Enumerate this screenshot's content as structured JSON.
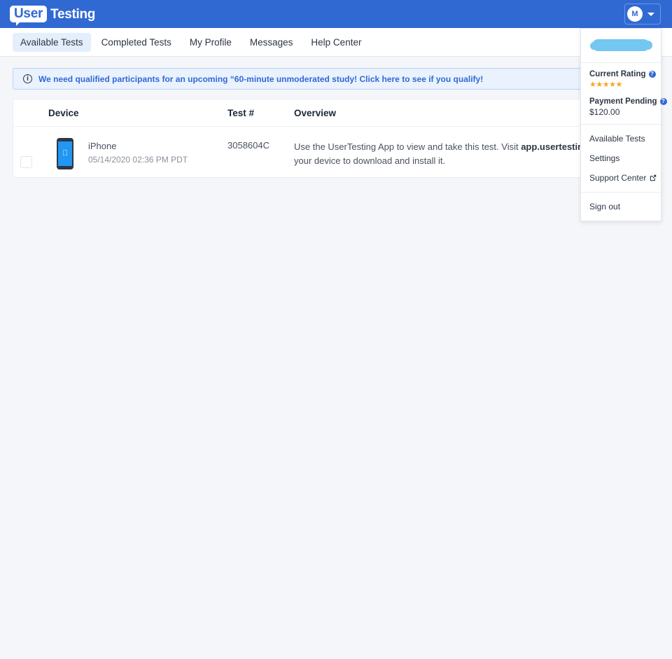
{
  "brand": {
    "logo_bubble": "User",
    "logo_rest": "Testing",
    "header_color": "#3169d3"
  },
  "account": {
    "avatar_initial": "M",
    "caret_icon": "chevron-down-icon"
  },
  "nav": {
    "tabs": [
      {
        "label": "Available Tests",
        "active": true
      },
      {
        "label": "Completed Tests",
        "active": false
      },
      {
        "label": "My Profile",
        "active": false
      },
      {
        "label": "Messages",
        "active": false
      },
      {
        "label": "Help Center",
        "active": false
      }
    ]
  },
  "banner": {
    "icon": "info-circle-icon",
    "text": "We need qualified participants for an upcoming “60-minute unmoderated study! Click here to see if you qualify!",
    "text_color": "#3169d3",
    "background": "#eaf2fd"
  },
  "table": {
    "columns": {
      "device": "Device",
      "test_number": "Test #",
      "overview": "Overview"
    },
    "rows": [
      {
        "checkbox_checked": false,
        "device_icon": "iphone-icon",
        "device_name": "iPhone",
        "device_date": "05/14/2020 02:36 PM PDT",
        "test_number": "3058604C",
        "overview_prefix": "Use the UserTesting App to view and take this test. Visit ",
        "overview_link": "app.usertesting.com/app",
        "overview_suffix": " on your device to download and install it."
      }
    ]
  },
  "dropdown": {
    "username_redacted": true,
    "rating": {
      "label": "Current Rating",
      "help_icon": "help-circle-icon",
      "stars": "★★★★★",
      "star_count": 5,
      "star_color": "#f5a623"
    },
    "payment": {
      "label": "Payment Pending",
      "help_icon": "help-circle-icon",
      "amount": "$120.00"
    },
    "items": [
      {
        "label": "Available Tests",
        "external": false
      },
      {
        "label": "Settings",
        "external": false
      },
      {
        "label": "Support Center",
        "external": true,
        "icon": "external-link-icon"
      }
    ],
    "signout": {
      "label": "Sign out"
    }
  }
}
